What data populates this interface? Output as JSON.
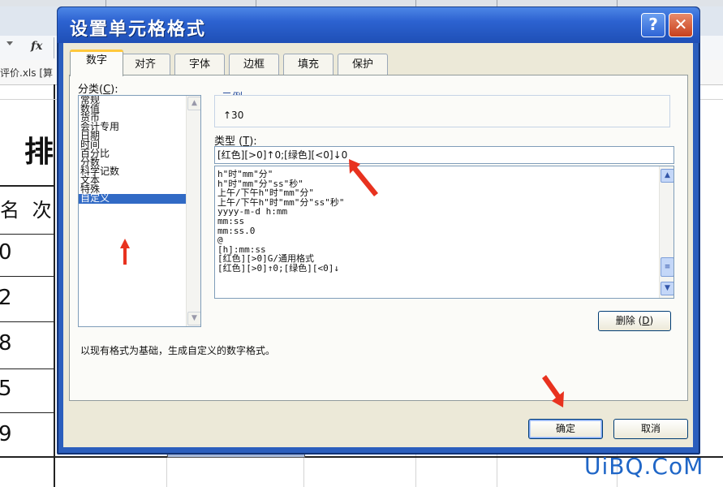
{
  "dialog": {
    "title": "设置单元格格式",
    "help_label": "?",
    "close_label": "✕",
    "tabs": [
      "数字",
      "对齐",
      "字体",
      "边框",
      "填充",
      "保护"
    ],
    "active_tab": "数字",
    "category_label": "分类",
    "category_hotkey": "C",
    "categories": [
      "常规",
      "数值",
      "货币",
      "会计专用",
      "日期",
      "时间",
      "百分比",
      "分数",
      "科学记数",
      "文本",
      "特殊",
      "自定义"
    ],
    "selected_category": "自定义",
    "sample_label": "示例",
    "sample_value": "↑30",
    "type_label": "类型",
    "type_hotkey": "T",
    "type_value": "[红色][>0]↑0;[绿色][<0]↓0",
    "formats": [
      "h\"时\"mm\"分\"",
      "h\"时\"mm\"分\"ss\"秒\"",
      "上午/下午h\"时\"mm\"分\"",
      "上午/下午h\"时\"mm\"分\"ss\"秒\"",
      "yyyy-m-d h:mm",
      "mm:ss",
      "mm:ss.0",
      "@",
      "[h]:mm:ss",
      "[红色][>0]G/通用格式",
      "[红色][>0]↑0;[绿色][<0]↓"
    ],
    "delete_label": "删除",
    "delete_hotkey": "D",
    "description": "以现有格式为基础，生成自定义的数字格式。",
    "ok_label": "确定",
    "cancel_label": "取消"
  },
  "spreadsheet": {
    "fx_label": "fx",
    "file_tab": "评价.xls  [算",
    "header_char": "排",
    "column_header": "名 次",
    "values": [
      "0",
      "2",
      "8",
      "5",
      "9"
    ]
  },
  "watermark": "UiBQ.CoM",
  "colors": {
    "accent": "#316ac5",
    "titlebar": "#2c62d0",
    "annotation_arrow": "#e8321f"
  }
}
